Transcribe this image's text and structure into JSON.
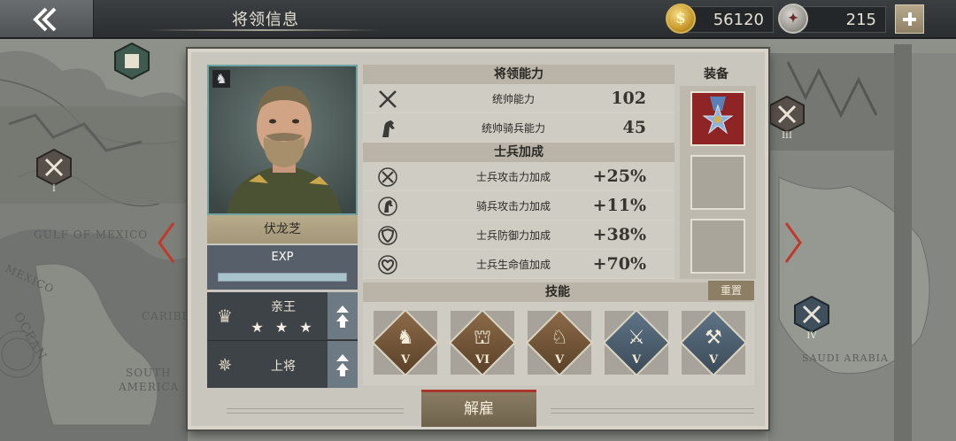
{
  "header": {
    "title": "将领信息",
    "coins": "56120",
    "medals": "215",
    "coin_icon": "coin-icon",
    "medal_icon": "medal-icon"
  },
  "map": {
    "labels": [
      "GULF OF MEXICO",
      "MEXICO",
      "CARIBE",
      "OCEAN",
      "SOUTH",
      "AMERICA",
      "SAUDI ARABIA"
    ],
    "markers": [
      "I",
      "III",
      "IV"
    ]
  },
  "general": {
    "name": "伏龙芝",
    "exp_label": "EXP",
    "exp_progress": 1.0,
    "rank_title": "亲王",
    "rank_stars": "★ ★ ★",
    "military_rank": "上将"
  },
  "abilities": {
    "header": "将领能力",
    "rows": [
      {
        "label": "统帅能力",
        "value": "102",
        "icon": "swords-icon"
      },
      {
        "label": "统帅骑兵能力",
        "value": "45",
        "icon": "horse-icon"
      }
    ]
  },
  "bonuses": {
    "header": "士兵加成",
    "rows": [
      {
        "label": "士兵攻击力加成",
        "value": "+25%",
        "icon": "attack-plus-icon"
      },
      {
        "label": "骑兵攻击力加成",
        "value": "+11%",
        "icon": "cavalry-plus-icon"
      },
      {
        "label": "士兵防御力加成",
        "value": "+38%",
        "icon": "shield-plus-icon"
      },
      {
        "label": "士兵生命值加成",
        "value": "+70%",
        "icon": "heart-plus-icon"
      }
    ]
  },
  "equipment": {
    "header": "装备",
    "slots": [
      "medal-equipment-icon",
      "empty-slot",
      "empty-slot"
    ]
  },
  "skills": {
    "header": "技能",
    "reset_label": "重置",
    "items": [
      {
        "level": "V",
        "icon": "cavalry-charge-icon",
        "color": "brown"
      },
      {
        "level": "VI",
        "icon": "fortification-icon",
        "color": "brown"
      },
      {
        "level": "V",
        "icon": "horse-head-icon",
        "color": "brown"
      },
      {
        "level": "V",
        "icon": "saber-icon",
        "color": "blue"
      },
      {
        "level": "V",
        "icon": "tools-icon",
        "color": "blue"
      }
    ]
  },
  "footer": {
    "dismiss_label": "解雇"
  },
  "colors": {
    "accent_red": "#a8362c",
    "panel": "#c9c6bd",
    "topbar": "#2b2e30"
  }
}
